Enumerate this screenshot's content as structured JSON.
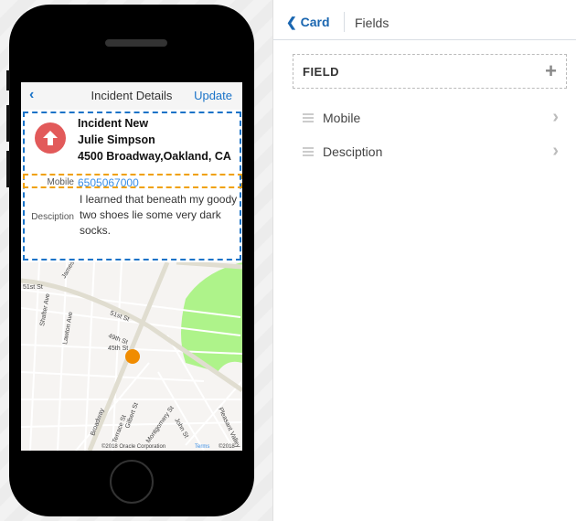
{
  "phone": {
    "header": {
      "back_icon": "chevron-left-icon",
      "title": "Incident Details",
      "update_label": "Update"
    },
    "card": {
      "status_icon": "arrow-up-icon",
      "status_color": "#e25a5a",
      "line1": "Incident New",
      "line2": "Julie Simpson",
      "line3": "4500 Broadway,Oakland, CA"
    },
    "mobile": {
      "label": "Mobile",
      "value": "6505067000"
    },
    "description": {
      "label": "Desciption",
      "value": "I learned that beneath my goody two shoes lie some very dark socks."
    },
    "map": {
      "streets": [
        "51st St",
        "James",
        "51st St",
        "Shafter Ave",
        "Lawton Ave",
        "49th St",
        "45th St",
        "Broadway",
        "Terrace St",
        "Gilbert St",
        "Montgomery St",
        "John St",
        "Pleasant Valley"
      ],
      "copyright": "©2018 Oracle Corporation",
      "terms": "Terms",
      "copyright2": "©2018",
      "marker_color": "#f08c00"
    }
  },
  "panel": {
    "back_label": "Card",
    "title": "Fields",
    "field_header": "FIELD",
    "add_icon": "plus-icon",
    "items": [
      {
        "label": "Mobile"
      },
      {
        "label": "Desciption"
      }
    ]
  }
}
